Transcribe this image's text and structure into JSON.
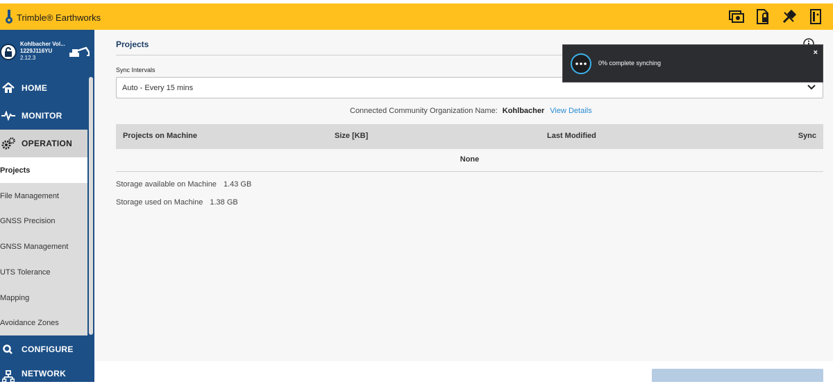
{
  "app": {
    "brand": "Trimble® Earthworks"
  },
  "header": {
    "icons": [
      "machine-sync-icon",
      "file-lock-icon",
      "tools-icon",
      "manual-icon"
    ]
  },
  "machine": {
    "name": "Kohlbacher Vol...",
    "id": "1229J116YU",
    "version": "2.12.3"
  },
  "nav": {
    "home": "HOME",
    "monitor": "MONITOR",
    "operation": "OPERATION",
    "configure": "CONFIGURE",
    "network": "NETWORK",
    "sub": [
      "Projects",
      "File Management",
      "GNSS Precision",
      "GNSS Management",
      "UTS Tolerance",
      "Mapping",
      "Avoidance Zones"
    ]
  },
  "page": {
    "title": "Projects",
    "sync_label": "Sync Intervals",
    "sync_value": "Auto - Every 15 mins",
    "org_label": "Connected Community Organization Name:",
    "org_name": "Kohlbacher",
    "view_details": "View Details"
  },
  "table": {
    "headers": [
      "Projects on Machine",
      "Size [KB]",
      "Last Modified",
      "Sync"
    ],
    "empty": "None"
  },
  "storage": {
    "available_label": "Storage available on Machine",
    "available_value": "1.43 GB",
    "used_label": "Storage used on Machine",
    "used_value": "1.38 GB"
  },
  "toast": {
    "message": "0% complete synching",
    "close": "×"
  },
  "colors": {
    "accent": "#ffc01e",
    "nav_blue": "#1c4f86",
    "link": "#2b8bd0",
    "toast_bg": "#2c2d31"
  }
}
